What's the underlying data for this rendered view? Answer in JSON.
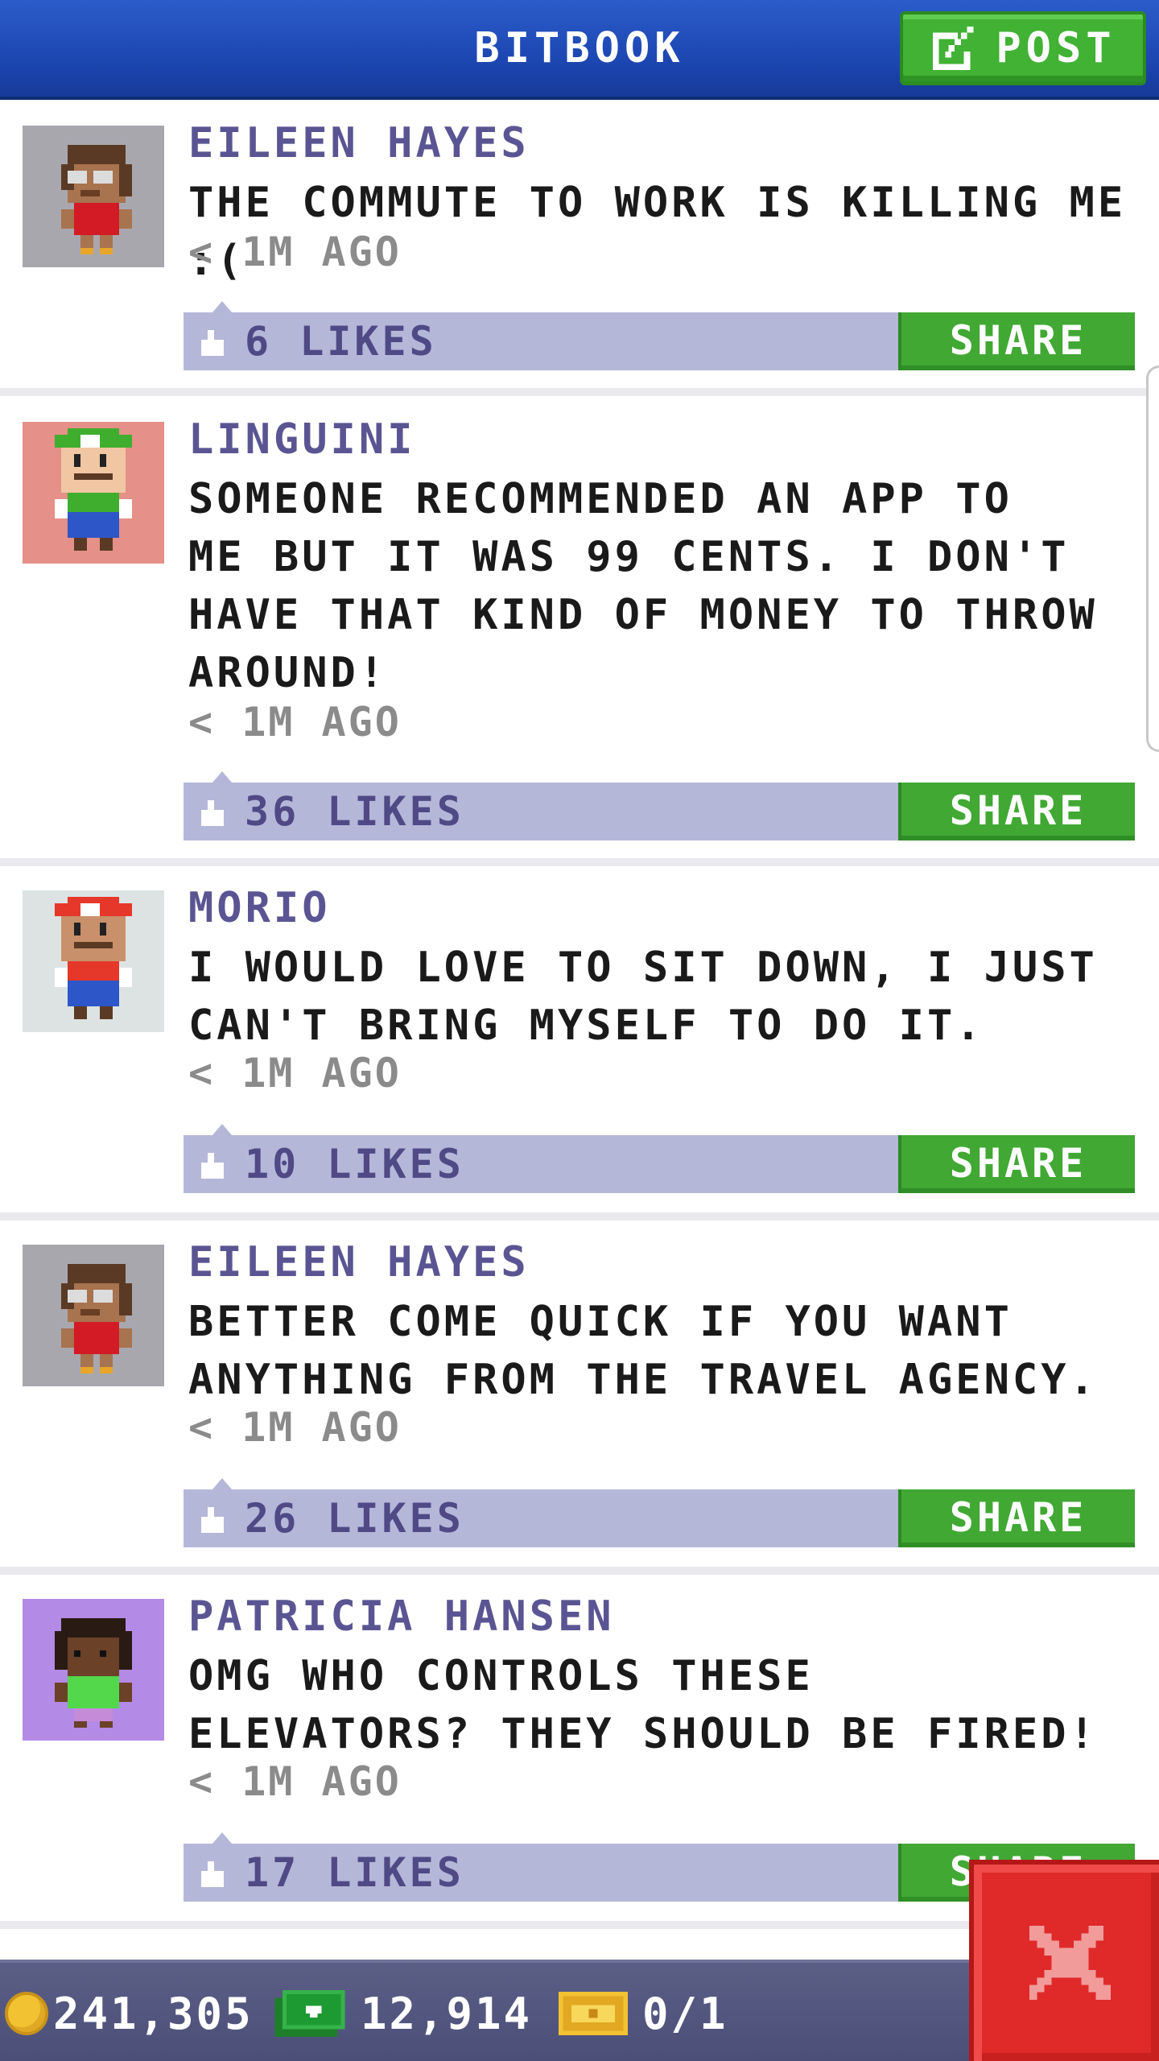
{
  "header": {
    "title": "BITBOOK",
    "post_label": "POST"
  },
  "posts": [
    {
      "author": "EILEEN HAYES",
      "message": "THE COMMUTE TO WORK IS KILLING ME :(",
      "time": "< 1M AGO",
      "likes": "6 LIKES",
      "share": "SHARE",
      "avatar_bg": "#a9a7ae"
    },
    {
      "author": "LINGUINI",
      "message": "SOMEONE RECOMMENDED AN APP TO\nME BUT IT WAS 99 CENTS. I DON'T\nHAVE THAT KIND OF MONEY TO THROW\nAROUND!",
      "time": "< 1M AGO",
      "likes": "36 LIKES",
      "share": "SHARE",
      "avatar_bg": "#e59088"
    },
    {
      "author": "MORIO",
      "message": "I WOULD LOVE TO SIT DOWN, I JUST\nCAN'T BRING MYSELF TO DO IT.",
      "time": "< 1M AGO",
      "likes": "10 LIKES",
      "share": "SHARE",
      "avatar_bg": "#dde3e3"
    },
    {
      "author": "EILEEN HAYES",
      "message": "BETTER COME QUICK IF YOU WANT\nANYTHING FROM THE TRAVEL AGENCY.",
      "time": "< 1M AGO",
      "likes": "26 LIKES",
      "share": "SHARE",
      "avatar_bg": "#a9a7ae"
    },
    {
      "author": "PATRICIA HANSEN",
      "message": "OMG WHO CONTROLS THESE\nELEVATORS? THEY SHOULD BE FIRED!",
      "time": "< 1M AGO",
      "likes": "17 LIKES",
      "share": "SHARE",
      "avatar_bg": "#b38ae6"
    }
  ],
  "status": {
    "coins": "241,305",
    "cash": "12,914",
    "tickets": "0/1"
  },
  "icons": {
    "post": "edit-icon",
    "like": "thumbs-up-icon",
    "coins": "coin-icon",
    "cash": "cash-icon",
    "tickets": "ticket-icon",
    "close": "close-icon"
  },
  "colors": {
    "header_blue": "#1d47b3",
    "button_green": "#41b234",
    "like_bar": "#b5b7d9",
    "author_purple": "#5a5592",
    "close_red": "#e02a2a"
  }
}
